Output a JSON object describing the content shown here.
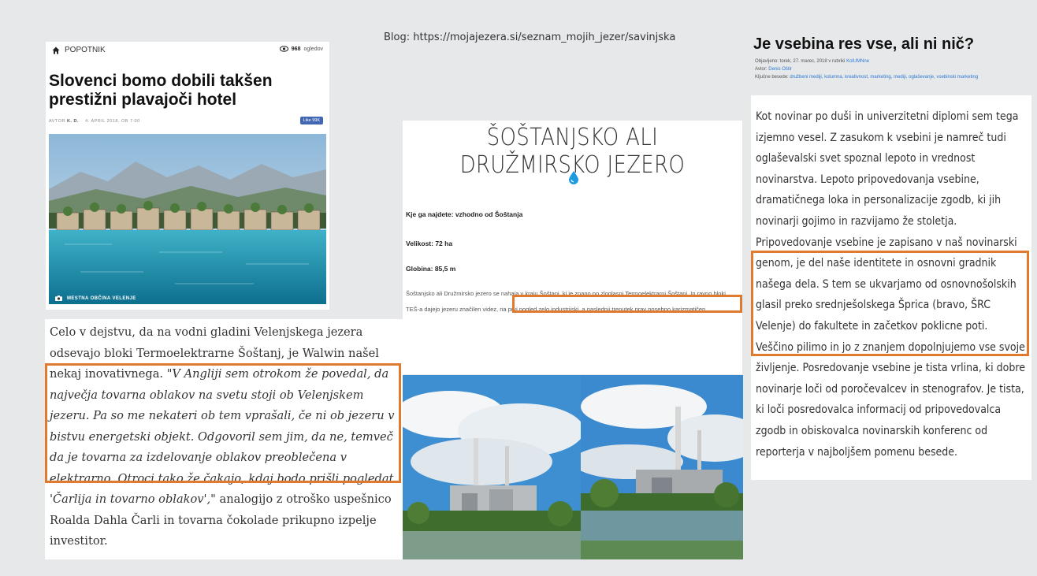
{
  "blog_url": "Blog: https://mojajezera.si/seznam_mojih_jezer/savinjska",
  "news_card": {
    "category": "POPOTNIK",
    "views_count": "968",
    "views_label": "ogledov",
    "title": "Slovenci bomo dobili takšen prestižni plavajoči hotel",
    "author_label": "AVTOR",
    "author": "K. D.",
    "date": "4. APRIL 2018, OB 7:00",
    "like_button": "Like 99K",
    "photo_caption": "MESTNA OBČINA VELENJE"
  },
  "article_left": {
    "p1": "Celo v dejstvu, da na vodni gladini Velenjskega jezera odsevajo bloki Termoelektrarne Šoštanj, je Walwin našel nekaj inovativnega. ",
    "quote": "\"V Angliji sem otrokom že povedal, da največja tovarna oblakov na svetu stoji ob Velenjskem jezeru. Pa so me nekateri ob tem vprašali, če ni ob jezeru v bistvu energetski objekt. Odgovoril sem jim, da ne, temveč da je tovarna za izdelovanje oblakov preoblečena v elektrarno. Otroci tako že čakajo, kdaj bodo prišli pogledat 'Čarlija in tovarno oblakov',\"",
    "p2": " analogijo z otroško uspešnico Roalda Dahla Čarli in tovarna čokolade prikupno izpelje investitor."
  },
  "lake_card": {
    "title": "ŠOŠTANJSKO ALI DRUŽMIRSKO JEZERO",
    "where": "Kje ga najdete: vzhodno od Šoštanja",
    "size": "Velikost: 72 ha",
    "depth": "Globina: 85,5 m",
    "paragraph_a": "Šoštanjsko ali Družmirsko jezero se nahaja v kraju Šoštanj, ki je znano po zloglasni Termoelektrarni Šoštanj. In ravno bloki TEŠ-a dajejo jezeru značilen videz, ",
    "paragraph_b": "na prvi pogled zelo industrijski, a naslednji trenutek prav posebno karizmatičen."
  },
  "right_article": {
    "title": "Je vsebina res vse, ali ni nič?",
    "published": "Objavljeno: torek, 27. marec, 2018 v rubriki",
    "published_link": "KolUMNne",
    "author_label": "Avtor:",
    "author": "Denis Oštir",
    "tags_label": "Ključne besede:",
    "tags": "družbeni mediji, kolumna, kreativnost, marketing, mediji, oglaševanje, vsebinski marketing",
    "body": "Kot novinar po duši in univerzitetni diplomi sem tega izjemno vesel. Z zasukom k vsebini je namreč tudi oglaševalski svet spoznal lepoto in vrednost novinarstva. Lepoto pripovedovanja vsebine, dramatičnega loka in personalizacije zgodb, ki jih novinarji gojimo in razvijamo že stoletja. Pripovedovanje vsebine je zapisano v naš novinarski genom, je del naše identitete in osnovni gradnik našega dela. S tem se ukvarjamo od osnovnošolskih glasil preko srednješolskega Šprica (bravo, ŠRC Velenje) do fakultete in začetkov poklicne poti. Veščino pilimo in jo z znanjem dopolnjujemo vse svoje življenje. Posredovanje vsebine je tista vrlina, ki dobre novinarje loči od poročevalcev in stenografov. Je tista, ki loči posredovalca informacij od pripovedovalca zgodb in obiskovalca novinarskih konferenc od reporterja v najboljšem pomenu besede."
  },
  "colors": {
    "highlight": "#e07a2e",
    "background": "#e7e8e9",
    "link": "#2a7ad6",
    "drop": "#1e9be0"
  }
}
